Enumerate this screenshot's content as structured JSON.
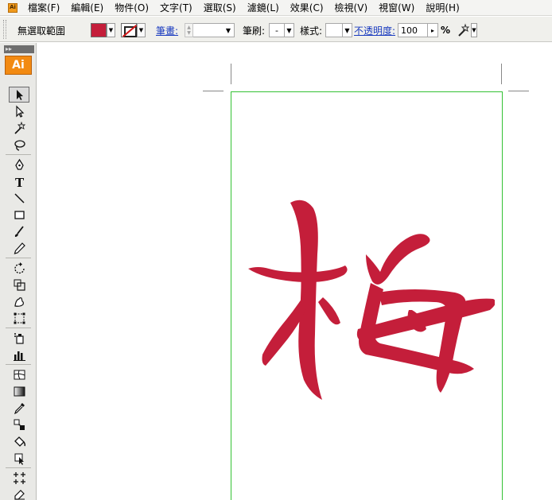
{
  "menubar": {
    "app_icon": "illustrator-app-icon",
    "items": [
      "檔案(F)",
      "編輯(E)",
      "物件(O)",
      "文字(T)",
      "選取(S)",
      "濾鏡(L)",
      "效果(C)",
      "檢視(V)",
      "視窗(W)",
      "說明(H)"
    ]
  },
  "controlbar": {
    "selection_status": "無選取範圍",
    "fill_color": "#c41e3a",
    "stroke_label": "筆畫:",
    "brush_label": "筆刷:",
    "brush_value": "-",
    "style_label": "樣式:",
    "opacity_label": "不透明度:",
    "opacity_value": "100",
    "opacity_unit": "%"
  },
  "tools": {
    "panel_collapse": "▸▸",
    "logo": "Ai"
  },
  "canvas": {
    "artboard_border_color": "#34c234",
    "glyph_color": "#c41e3a"
  }
}
